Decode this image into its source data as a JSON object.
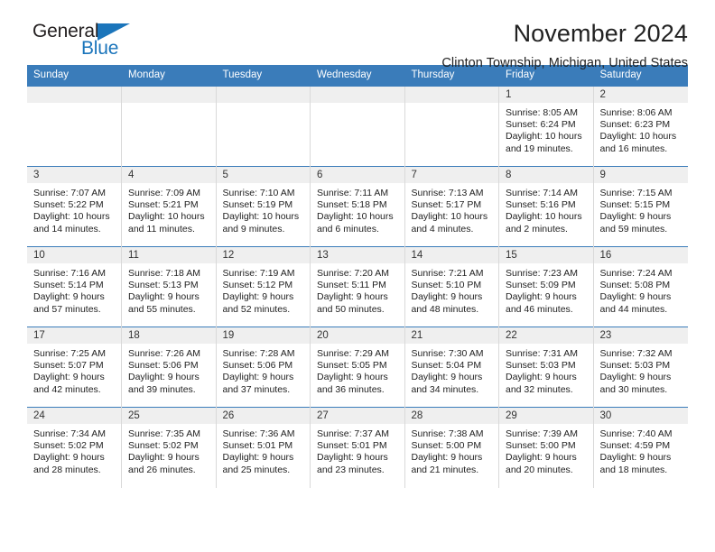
{
  "brand": {
    "name_top": "General",
    "name_bottom": "Blue",
    "accent_color": "#1b75bb"
  },
  "header": {
    "title": "November 2024",
    "subtitle": "Clinton Township, Michigan, United States"
  },
  "theme": {
    "header_blue": "#3a7cba",
    "daynum_background": "#efefef",
    "cell_background": "#ffffff"
  },
  "calendar": {
    "weekday_headers": [
      "Sunday",
      "Monday",
      "Tuesday",
      "Wednesday",
      "Thursday",
      "Friday",
      "Saturday"
    ],
    "labels": {
      "sunrise_prefix": "Sunrise:",
      "sunset_prefix": "Sunset:",
      "daylight_prefix": "Daylight:"
    },
    "weeks": [
      [
        {
          "day": "",
          "lines": [
            "",
            "",
            "",
            ""
          ]
        },
        {
          "day": "",
          "lines": [
            "",
            "",
            "",
            ""
          ]
        },
        {
          "day": "",
          "lines": [
            "",
            "",
            "",
            ""
          ]
        },
        {
          "day": "",
          "lines": [
            "",
            "",
            "",
            ""
          ]
        },
        {
          "day": "",
          "lines": [
            "",
            "",
            "",
            ""
          ]
        },
        {
          "day": "1",
          "lines": [
            "Sunrise: 8:05 AM",
            "Sunset: 6:24 PM",
            "Daylight: 10 hours",
            "and 19 minutes."
          ]
        },
        {
          "day": "2",
          "lines": [
            "Sunrise: 8:06 AM",
            "Sunset: 6:23 PM",
            "Daylight: 10 hours",
            "and 16 minutes."
          ]
        }
      ],
      [
        {
          "day": "3",
          "lines": [
            "Sunrise: 7:07 AM",
            "Sunset: 5:22 PM",
            "Daylight: 10 hours",
            "and 14 minutes."
          ]
        },
        {
          "day": "4",
          "lines": [
            "Sunrise: 7:09 AM",
            "Sunset: 5:21 PM",
            "Daylight: 10 hours",
            "and 11 minutes."
          ]
        },
        {
          "day": "5",
          "lines": [
            "Sunrise: 7:10 AM",
            "Sunset: 5:19 PM",
            "Daylight: 10 hours",
            "and 9 minutes."
          ]
        },
        {
          "day": "6",
          "lines": [
            "Sunrise: 7:11 AM",
            "Sunset: 5:18 PM",
            "Daylight: 10 hours",
            "and 6 minutes."
          ]
        },
        {
          "day": "7",
          "lines": [
            "Sunrise: 7:13 AM",
            "Sunset: 5:17 PM",
            "Daylight: 10 hours",
            "and 4 minutes."
          ]
        },
        {
          "day": "8",
          "lines": [
            "Sunrise: 7:14 AM",
            "Sunset: 5:16 PM",
            "Daylight: 10 hours",
            "and 2 minutes."
          ]
        },
        {
          "day": "9",
          "lines": [
            "Sunrise: 7:15 AM",
            "Sunset: 5:15 PM",
            "Daylight: 9 hours",
            "and 59 minutes."
          ]
        }
      ],
      [
        {
          "day": "10",
          "lines": [
            "Sunrise: 7:16 AM",
            "Sunset: 5:14 PM",
            "Daylight: 9 hours",
            "and 57 minutes."
          ]
        },
        {
          "day": "11",
          "lines": [
            "Sunrise: 7:18 AM",
            "Sunset: 5:13 PM",
            "Daylight: 9 hours",
            "and 55 minutes."
          ]
        },
        {
          "day": "12",
          "lines": [
            "Sunrise: 7:19 AM",
            "Sunset: 5:12 PM",
            "Daylight: 9 hours",
            "and 52 minutes."
          ]
        },
        {
          "day": "13",
          "lines": [
            "Sunrise: 7:20 AM",
            "Sunset: 5:11 PM",
            "Daylight: 9 hours",
            "and 50 minutes."
          ]
        },
        {
          "day": "14",
          "lines": [
            "Sunrise: 7:21 AM",
            "Sunset: 5:10 PM",
            "Daylight: 9 hours",
            "and 48 minutes."
          ]
        },
        {
          "day": "15",
          "lines": [
            "Sunrise: 7:23 AM",
            "Sunset: 5:09 PM",
            "Daylight: 9 hours",
            "and 46 minutes."
          ]
        },
        {
          "day": "16",
          "lines": [
            "Sunrise: 7:24 AM",
            "Sunset: 5:08 PM",
            "Daylight: 9 hours",
            "and 44 minutes."
          ]
        }
      ],
      [
        {
          "day": "17",
          "lines": [
            "Sunrise: 7:25 AM",
            "Sunset: 5:07 PM",
            "Daylight: 9 hours",
            "and 42 minutes."
          ]
        },
        {
          "day": "18",
          "lines": [
            "Sunrise: 7:26 AM",
            "Sunset: 5:06 PM",
            "Daylight: 9 hours",
            "and 39 minutes."
          ]
        },
        {
          "day": "19",
          "lines": [
            "Sunrise: 7:28 AM",
            "Sunset: 5:06 PM",
            "Daylight: 9 hours",
            "and 37 minutes."
          ]
        },
        {
          "day": "20",
          "lines": [
            "Sunrise: 7:29 AM",
            "Sunset: 5:05 PM",
            "Daylight: 9 hours",
            "and 36 minutes."
          ]
        },
        {
          "day": "21",
          "lines": [
            "Sunrise: 7:30 AM",
            "Sunset: 5:04 PM",
            "Daylight: 9 hours",
            "and 34 minutes."
          ]
        },
        {
          "day": "22",
          "lines": [
            "Sunrise: 7:31 AM",
            "Sunset: 5:03 PM",
            "Daylight: 9 hours",
            "and 32 minutes."
          ]
        },
        {
          "day": "23",
          "lines": [
            "Sunrise: 7:32 AM",
            "Sunset: 5:03 PM",
            "Daylight: 9 hours",
            "and 30 minutes."
          ]
        }
      ],
      [
        {
          "day": "24",
          "lines": [
            "Sunrise: 7:34 AM",
            "Sunset: 5:02 PM",
            "Daylight: 9 hours",
            "and 28 minutes."
          ]
        },
        {
          "day": "25",
          "lines": [
            "Sunrise: 7:35 AM",
            "Sunset: 5:02 PM",
            "Daylight: 9 hours",
            "and 26 minutes."
          ]
        },
        {
          "day": "26",
          "lines": [
            "Sunrise: 7:36 AM",
            "Sunset: 5:01 PM",
            "Daylight: 9 hours",
            "and 25 minutes."
          ]
        },
        {
          "day": "27",
          "lines": [
            "Sunrise: 7:37 AM",
            "Sunset: 5:01 PM",
            "Daylight: 9 hours",
            "and 23 minutes."
          ]
        },
        {
          "day": "28",
          "lines": [
            "Sunrise: 7:38 AM",
            "Sunset: 5:00 PM",
            "Daylight: 9 hours",
            "and 21 minutes."
          ]
        },
        {
          "day": "29",
          "lines": [
            "Sunrise: 7:39 AM",
            "Sunset: 5:00 PM",
            "Daylight: 9 hours",
            "and 20 minutes."
          ]
        },
        {
          "day": "30",
          "lines": [
            "Sunrise: 7:40 AM",
            "Sunset: 4:59 PM",
            "Daylight: 9 hours",
            "and 18 minutes."
          ]
        }
      ]
    ]
  }
}
